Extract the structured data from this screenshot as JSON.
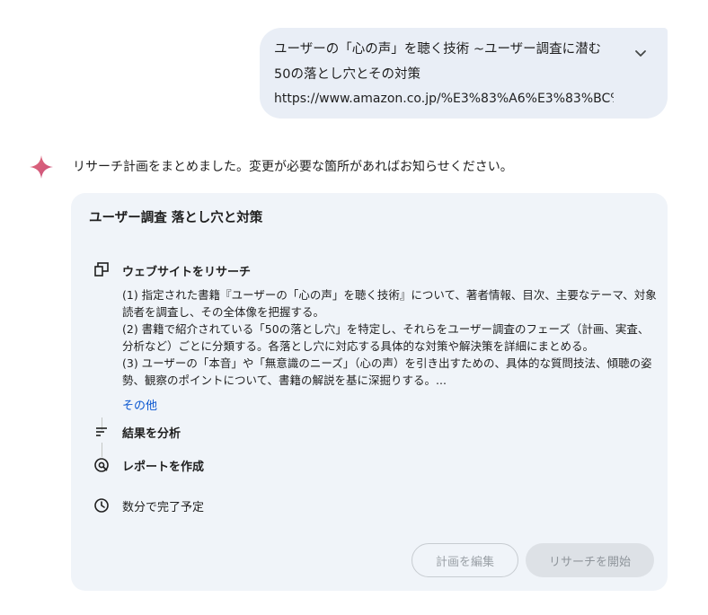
{
  "user_message": {
    "line1": "ユーザーの「心の声」を聴く技術 ~ユーザー調査に潜む",
    "line2": "50の落とし穴とその対策",
    "line3": "https://www.amazon.co.jp/%E3%83%A6%E3%83%BC%..."
  },
  "assistant": {
    "message": "リサーチ計画をまとめました。変更が必要な箇所があればお知らせください。"
  },
  "plan": {
    "title": "ユーザー調査 落とし穴と対策",
    "steps": [
      {
        "label": "ウェブサイトをリサーチ",
        "icon": "website-research-icon",
        "details": [
          "(1) 指定された書籍『ユーザーの「心の声」を聴く技術』について、著者情報、目次、主要なテーマ、対象読者を調査し、その全体像を把握する。",
          "(2) 書籍で紹介されている「50の落とし穴」を特定し、それらをユーザー調査のフェーズ（計画、実査、分析など）ごとに分類する。各落とし穴に対応する具体的な対策や解決策を詳細にまとめる。",
          "(3) ユーザーの「本音」や「無意識のニーズ」（心の声）を引き出すための、具体的な質問技法、傾聴の姿勢、観察のポイントについて、書籍の解説を基に深掘りする。..."
        ],
        "more_label": "その他"
      },
      {
        "label": "結果を分析",
        "icon": "analyze-results-icon"
      },
      {
        "label": "レポートを作成",
        "icon": "create-report-icon"
      }
    ],
    "eta": "数分で完了予定",
    "eta_icon": "clock-icon",
    "buttons": {
      "edit": "計画を編集",
      "start": "リサーチを開始"
    }
  },
  "colors": {
    "bubble_bg": "#e9eef6",
    "card_bg": "#f0f4f9",
    "link": "#0b57d0",
    "sparkle_start": "#e26a7a",
    "sparkle_end": "#c94f7c"
  }
}
